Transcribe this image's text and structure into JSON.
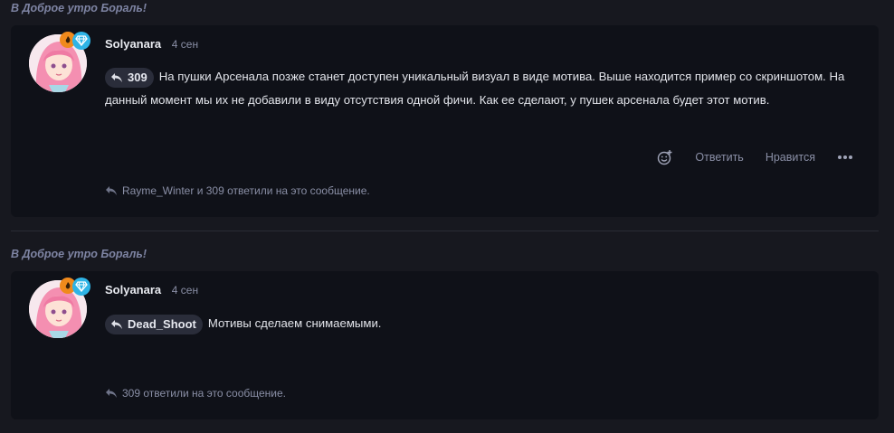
{
  "threads": [
    {
      "topic_title": "В Доброе утро Бораль!",
      "author": "Solyanara",
      "time": "4 сен",
      "reply_to": "309",
      "message": "На пушки Арсенала позже станет доступен уникальный визуал в виде мотива. Выше находится пример со скриншотом. На данный момент мы их не добавили в виду отсутствия одной фичи. Как ее сделают, у пушек арсенала будет этот мотив.",
      "actions": {
        "reply": "Ответить",
        "like": "Нравится"
      },
      "replies_note": "Rayme_Winter и 309 ответили на это сообщение."
    },
    {
      "topic_title": "В Доброе утро Бораль!",
      "author": "Solyanara",
      "time": "4 сен",
      "reply_to": "Dead_Shoot",
      "message": "Мотивы сделаем снимаемыми.",
      "replies_note": "309 ответили на это сообщение."
    }
  ],
  "colors": {
    "accent_orange": "#f08a1c",
    "accent_blue": "#2fb4e6",
    "muted": "#8a8fa6"
  }
}
